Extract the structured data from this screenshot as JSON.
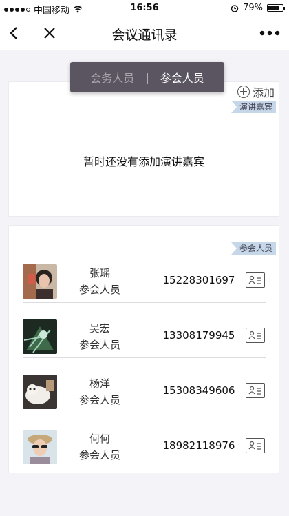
{
  "status_bar": {
    "carrier": "中国移动",
    "time": "16:56",
    "battery": "79%",
    "battery_level": 0.79
  },
  "nav": {
    "title": "会议通讯录",
    "back_icon": "chevron-left-icon",
    "close_icon": "close-icon",
    "more_icon": "more-dots-icon"
  },
  "segmented": {
    "tabs": [
      {
        "label": "会务人员",
        "active": false
      },
      {
        "label": "参会人员",
        "active": true
      }
    ],
    "separator": "|"
  },
  "speakers": {
    "add_label": "添加",
    "tag": "演讲嘉宾",
    "empty_text": "暂时还没有添加演讲嘉宾"
  },
  "attendees": {
    "tag": "参会人员",
    "items": [
      {
        "name": "张瑶",
        "role": "参会人员",
        "phone": "15228301697"
      },
      {
        "name": "吴宏",
        "role": "参会人员",
        "phone": "13308179945"
      },
      {
        "name": "杨洋",
        "role": "参会人员",
        "phone": "15308349606"
      },
      {
        "name": "何何",
        "role": "参会人员",
        "phone": "18982118976"
      }
    ]
  },
  "colors": {
    "segment_bg": "#5a5560",
    "tag_bg": "#c5d7e8",
    "page_bg": "#f4f3f7"
  }
}
